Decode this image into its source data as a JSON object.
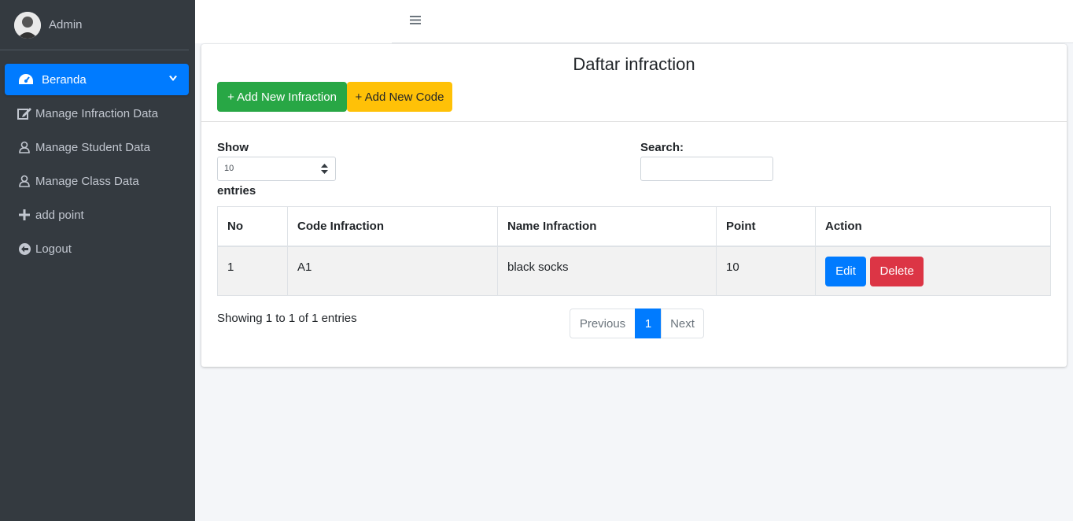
{
  "sidebar": {
    "user_name": "Admin",
    "items": [
      {
        "label": "Beranda",
        "icon": "tachometer-icon",
        "active": true
      },
      {
        "label": "Manage Infraction Data",
        "icon": "edit-icon"
      },
      {
        "label": "Manage Student Data",
        "icon": "user-icon"
      },
      {
        "label": "Manage Class Data",
        "icon": "user-icon"
      },
      {
        "label": "add point",
        "icon": "plus-icon"
      },
      {
        "label": "Logout",
        "icon": "arrow-circle-left-icon"
      }
    ]
  },
  "header": {
    "menu_icon": "hamburger-icon"
  },
  "main": {
    "title": "Daftar infraction",
    "add_infraction_label": "+ Add New Infraction",
    "add_code_label": "+ Add New Code",
    "show_label": "Show",
    "entries_label": "entries",
    "page_length": "10",
    "search_label": "Search:",
    "search_value": "",
    "table": {
      "columns": [
        "No",
        "Code Infraction",
        "Name Infraction",
        "Point",
        "Action"
      ],
      "rows": [
        {
          "no": "1",
          "code": "A1",
          "name": "black socks",
          "point": "10",
          "edit_label": "Edit",
          "delete_label": "Delete"
        }
      ]
    },
    "info": "Showing 1 to 1 of 1 entries",
    "pagination": {
      "previous": "Previous",
      "current": "1",
      "next": "Next"
    }
  },
  "colors": {
    "sidebar_bg": "#343a40",
    "active": "#007bff",
    "success": "#28a745",
    "warning": "#ffc107",
    "danger": "#dc3545"
  }
}
